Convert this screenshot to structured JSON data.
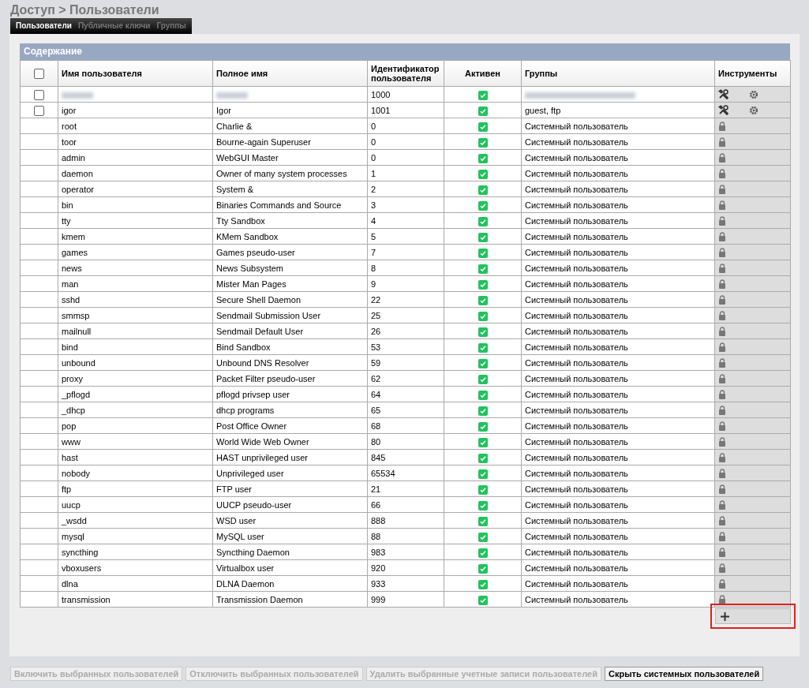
{
  "breadcrumb": "Доступ > Пользователи",
  "tabs": [
    {
      "label": "Пользователи",
      "selected": true
    },
    {
      "label": "Публичные ключи",
      "selected": false
    },
    {
      "label": "Группы",
      "selected": false
    }
  ],
  "section_title": "Содержание",
  "table": {
    "select_all": {
      "checked": false
    },
    "columns": [
      "Имя пользователя",
      "Полное имя",
      "Идентификатор пользователя",
      "Активен",
      "Группы",
      "Инструменты"
    ],
    "rows": [
      {
        "kind": "user",
        "redacted": true,
        "checked": false,
        "username": "",
        "fullname": "",
        "uid": "1000",
        "active": true,
        "groups": ""
      },
      {
        "kind": "user",
        "redacted": false,
        "checked": false,
        "username": "igor",
        "fullname": "Igor",
        "uid": "1001",
        "active": true,
        "groups": "guest, ftp"
      },
      {
        "kind": "system",
        "username": "root",
        "fullname": "Charlie &",
        "uid": "0",
        "active": true,
        "groups": "Системный пользователь"
      },
      {
        "kind": "system",
        "username": "toor",
        "fullname": "Bourne-again Superuser",
        "uid": "0",
        "active": true,
        "groups": "Системный пользователь"
      },
      {
        "kind": "system",
        "username": "admin",
        "fullname": "WebGUI Master",
        "uid": "0",
        "active": true,
        "groups": "Системный пользователь"
      },
      {
        "kind": "system",
        "username": "daemon",
        "fullname": "Owner of many system processes",
        "uid": "1",
        "active": true,
        "groups": "Системный пользователь"
      },
      {
        "kind": "system",
        "username": "operator",
        "fullname": "System &",
        "uid": "2",
        "active": true,
        "groups": "Системный пользователь"
      },
      {
        "kind": "system",
        "username": "bin",
        "fullname": "Binaries Commands and Source",
        "uid": "3",
        "active": true,
        "groups": "Системный пользователь"
      },
      {
        "kind": "system",
        "username": "tty",
        "fullname": "Tty Sandbox",
        "uid": "4",
        "active": true,
        "groups": "Системный пользователь"
      },
      {
        "kind": "system",
        "username": "kmem",
        "fullname": "KMem Sandbox",
        "uid": "5",
        "active": true,
        "groups": "Системный пользователь"
      },
      {
        "kind": "system",
        "username": "games",
        "fullname": "Games pseudo-user",
        "uid": "7",
        "active": true,
        "groups": "Системный пользователь"
      },
      {
        "kind": "system",
        "username": "news",
        "fullname": "News Subsystem",
        "uid": "8",
        "active": true,
        "groups": "Системный пользователь"
      },
      {
        "kind": "system",
        "username": "man",
        "fullname": "Mister Man Pages",
        "uid": "9",
        "active": true,
        "groups": "Системный пользователь"
      },
      {
        "kind": "system",
        "username": "sshd",
        "fullname": "Secure Shell Daemon",
        "uid": "22",
        "active": true,
        "groups": "Системный пользователь"
      },
      {
        "kind": "system",
        "username": "smmsp",
        "fullname": "Sendmail Submission User",
        "uid": "25",
        "active": true,
        "groups": "Системный пользователь"
      },
      {
        "kind": "system",
        "username": "mailnull",
        "fullname": "Sendmail Default User",
        "uid": "26",
        "active": true,
        "groups": "Системный пользователь"
      },
      {
        "kind": "system",
        "username": "bind",
        "fullname": "Bind Sandbox",
        "uid": "53",
        "active": true,
        "groups": "Системный пользователь"
      },
      {
        "kind": "system",
        "username": "unbound",
        "fullname": "Unbound DNS Resolver",
        "uid": "59",
        "active": true,
        "groups": "Системный пользователь"
      },
      {
        "kind": "system",
        "username": "proxy",
        "fullname": "Packet Filter pseudo-user",
        "uid": "62",
        "active": true,
        "groups": "Системный пользователь"
      },
      {
        "kind": "system",
        "username": "_pflogd",
        "fullname": "pflogd privsep user",
        "uid": "64",
        "active": true,
        "groups": "Системный пользователь"
      },
      {
        "kind": "system",
        "username": "_dhcp",
        "fullname": "dhcp programs",
        "uid": "65",
        "active": true,
        "groups": "Системный пользователь"
      },
      {
        "kind": "system",
        "username": "pop",
        "fullname": "Post Office Owner",
        "uid": "68",
        "active": true,
        "groups": "Системный пользователь"
      },
      {
        "kind": "system",
        "username": "www",
        "fullname": "World Wide Web Owner",
        "uid": "80",
        "active": true,
        "groups": "Системный пользователь"
      },
      {
        "kind": "system",
        "username": "hast",
        "fullname": "HAST unprivileged user",
        "uid": "845",
        "active": true,
        "groups": "Системный пользователь"
      },
      {
        "kind": "system",
        "username": "nobody",
        "fullname": "Unprivileged user",
        "uid": "65534",
        "active": true,
        "groups": "Системный пользователь"
      },
      {
        "kind": "system",
        "username": "ftp",
        "fullname": "FTP user",
        "uid": "21",
        "active": true,
        "groups": "Системный пользователь"
      },
      {
        "kind": "system",
        "username": "uucp",
        "fullname": "UUCP pseudo-user",
        "uid": "66",
        "active": true,
        "groups": "Системный пользователь"
      },
      {
        "kind": "system",
        "username": "_wsdd",
        "fullname": "WSD user",
        "uid": "888",
        "active": true,
        "groups": "Системный пользователь"
      },
      {
        "kind": "system",
        "username": "mysql",
        "fullname": "MySQL user",
        "uid": "88",
        "active": true,
        "groups": "Системный пользователь"
      },
      {
        "kind": "system",
        "username": "syncthing",
        "fullname": "Syncthing Daemon",
        "uid": "983",
        "active": true,
        "groups": "Системный пользователь"
      },
      {
        "kind": "system",
        "username": "vboxusers",
        "fullname": "Virtualbox user",
        "uid": "920",
        "active": true,
        "groups": "Системный пользователь"
      },
      {
        "kind": "system",
        "username": "dlna",
        "fullname": "DLNA Daemon",
        "uid": "933",
        "active": true,
        "groups": "Системный пользователь"
      },
      {
        "kind": "system",
        "username": "transmission",
        "fullname": "Transmission Daemon",
        "uid": "999",
        "active": true,
        "groups": "Системный пользователь"
      }
    ]
  },
  "add_button": {
    "highlighted": true
  },
  "buttons": [
    {
      "label": "Включить выбранных пользователей",
      "disabled": true
    },
    {
      "label": "Отключить выбранных пользователей",
      "disabled": true
    },
    {
      "label": "Удалить выбранные учетные записи пользователей",
      "disabled": true
    },
    {
      "label": "Скрыть системных пользователей",
      "disabled": false
    }
  ]
}
